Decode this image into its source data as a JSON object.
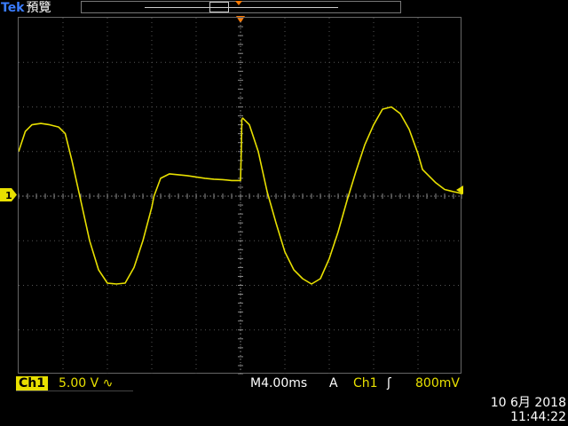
{
  "header": {
    "brand": "Tek",
    "mode": "預覽"
  },
  "channel": {
    "label": "Ch1",
    "volts_per_div": "5.00 V",
    "coupling_symbol": "∿",
    "ground_marker": "1",
    "color": "#e8e000"
  },
  "timebase": {
    "label": "M4.00ms"
  },
  "trigger": {
    "mode": "A",
    "source": "Ch1",
    "edge_symbol": "ʃ",
    "level": "800mV",
    "marker_color": "#ff7a00"
  },
  "datetime": {
    "date": "10 6月  2018",
    "time": "11:44:22"
  },
  "chart_data": {
    "type": "line",
    "grid": true,
    "x_divisions": 10,
    "y_divisions": 8,
    "ylim": [
      -4,
      4
    ],
    "xlim": [
      0,
      10
    ],
    "series": [
      {
        "color": "#e8e000",
        "x": [
          0,
          0.15,
          0.3,
          0.5,
          0.7,
          0.9,
          1.05,
          1.2,
          1.4,
          1.6,
          1.8,
          2.0,
          2.2,
          2.4,
          2.6,
          2.8,
          3.0,
          3.05,
          3.2,
          3.4,
          3.6,
          3.8,
          4.0,
          4.2,
          4.4,
          4.6,
          4.8,
          5.0,
          5.02,
          5.03,
          5.05,
          5.2,
          5.4,
          5.6,
          5.8,
          6.0,
          6.2,
          6.4,
          6.6,
          6.8,
          7.0,
          7.2,
          7.4,
          7.6,
          7.8,
          8.0,
          8.2,
          8.4,
          8.6,
          8.8,
          9.0,
          9.1,
          9.2,
          9.4,
          9.6,
          9.8,
          9.9,
          10.0
        ],
        "y": [
          1.0,
          1.45,
          1.6,
          1.63,
          1.6,
          1.55,
          1.4,
          0.8,
          -0.1,
          -1.0,
          -1.65,
          -1.95,
          -1.97,
          -1.95,
          -1.6,
          -1.0,
          -0.25,
          0.0,
          0.4,
          0.5,
          0.48,
          0.46,
          0.43,
          0.4,
          0.38,
          0.37,
          0.35,
          0.35,
          1.1,
          1.72,
          1.75,
          1.6,
          1.0,
          0.1,
          -0.6,
          -1.25,
          -1.65,
          -1.85,
          -1.97,
          -1.85,
          -1.4,
          -0.8,
          -0.1,
          0.55,
          1.15,
          1.6,
          1.95,
          2.0,
          1.85,
          1.5,
          0.95,
          0.6,
          0.5,
          0.3,
          0.15,
          0.1,
          0.08,
          0.05
        ]
      }
    ]
  }
}
